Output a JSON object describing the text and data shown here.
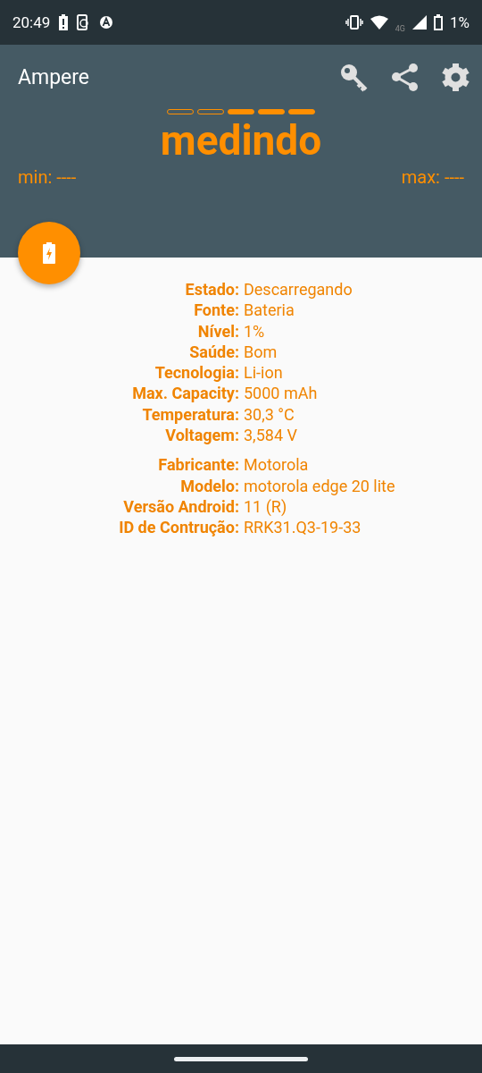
{
  "status_bar": {
    "time": "20:49",
    "battery": "1%",
    "network": "4G"
  },
  "app_bar": {
    "title": "Ampere"
  },
  "meter": {
    "segments": [
      {
        "filled": false
      },
      {
        "filled": false
      },
      {
        "filled": true
      },
      {
        "filled": true
      },
      {
        "filled": true
      }
    ],
    "status": "medindo",
    "min": "min: ----",
    "max": "max: ----"
  },
  "info_groups": [
    {
      "rows": [
        {
          "label": "Estado:",
          "value": "Descarregando"
        },
        {
          "label": "Fonte:",
          "value": "Bateria"
        },
        {
          "label": "Nível:",
          "value": "1%"
        },
        {
          "label": "Saúde:",
          "value": "Bom"
        },
        {
          "label": "Tecnologia:",
          "value": "Li-ion"
        },
        {
          "label": "Max. Capacity:",
          "value": "5000 mAh"
        },
        {
          "label": "Temperatura:",
          "value": "30,3 °C"
        },
        {
          "label": "Voltagem:",
          "value": "3,584 V"
        }
      ]
    },
    {
      "rows": [
        {
          "label": "Fabricante:",
          "value": "Motorola"
        },
        {
          "label": "Modelo:",
          "value": "motorola edge 20 lite"
        },
        {
          "label": "Versão Android:",
          "value": "11 (R)"
        },
        {
          "label": "ID de Contrução:",
          "value": "RRK31.Q3-19-33"
        }
      ]
    }
  ]
}
